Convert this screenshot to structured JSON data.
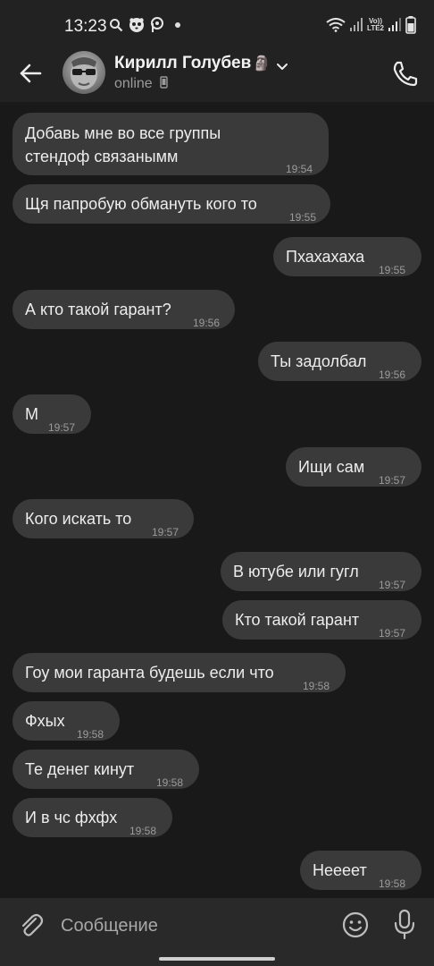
{
  "status_bar": {
    "time": "13:23",
    "network_label": "Vo))\nLTE2",
    "icons": [
      "search-icon",
      "panda-icon",
      "parking-icon",
      "dot",
      "wifi-icon",
      "signal-icon",
      "battery-icon"
    ]
  },
  "header": {
    "contact_name": "Кирилл Голубев",
    "name_emoji": "🗿",
    "status": "online",
    "icons": [
      "back-arrow-icon",
      "chevron-down-icon",
      "mobile-icon",
      "phone-icon"
    ]
  },
  "messages": [
    {
      "side": "in",
      "text": "Добавь мне во все группы стендоф связанымм",
      "time": "19:54"
    },
    {
      "side": "in",
      "text": "Щя папробую обмануть кого то",
      "time": "19:55"
    },
    {
      "side": "out",
      "text": "Пхахахаха",
      "time": "19:55"
    },
    {
      "side": "in",
      "text": "А кто такой гарант?",
      "time": "19:56"
    },
    {
      "side": "out",
      "text": "Ты задолбал",
      "time": "19:56"
    },
    {
      "side": "in",
      "text": "М",
      "time": "19:57"
    },
    {
      "side": "out",
      "text": "Ищи сам",
      "time": "19:57"
    },
    {
      "side": "in",
      "text": "Кого искать то",
      "time": "19:57"
    },
    {
      "side": "out",
      "text": "В ютубе или гугл",
      "time": "19:57"
    },
    {
      "side": "out",
      "text": "Кто такой гарант",
      "time": "19:57"
    },
    {
      "side": "in",
      "text": "Гоу мои гаранта будешь если что",
      "time": "19:58"
    },
    {
      "side": "in",
      "text": "Фхых",
      "time": "19:58"
    },
    {
      "side": "in",
      "text": "Те денег кинут",
      "time": "19:58"
    },
    {
      "side": "in",
      "text": "И в чс фхфх",
      "time": "19:58"
    },
    {
      "side": "out",
      "text": "Неееет",
      "time": "19:58"
    }
  ],
  "composer": {
    "placeholder": "Сообщение",
    "icons": [
      "paperclip-icon",
      "emoji-icon",
      "microphone-icon"
    ]
  },
  "colors": {
    "background": "#19191a",
    "header": "#222223",
    "bubble": "#3a3a3b",
    "composer": "#29292a"
  }
}
